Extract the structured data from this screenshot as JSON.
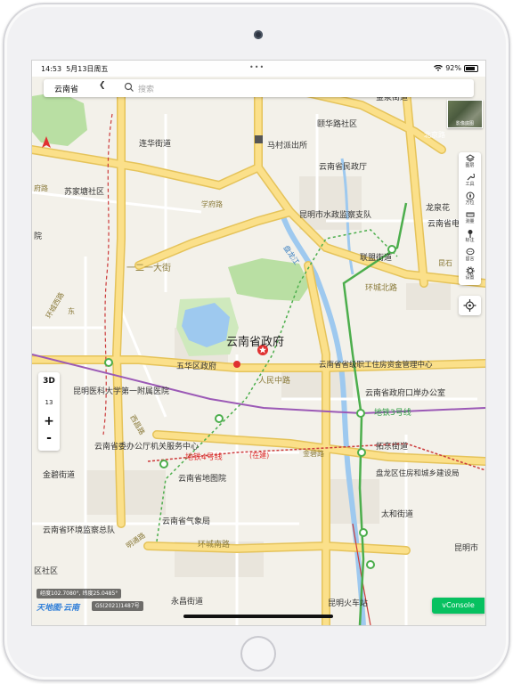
{
  "status_bar": {
    "time": "14:53",
    "date": "5月13日周五",
    "dots": "•••",
    "battery": "92%"
  },
  "search": {
    "province": "云南省",
    "placeholder": "搜索"
  },
  "imagery_thumb": {
    "label": "影像底图"
  },
  "tools": [
    {
      "icon": "layers-icon",
      "label": "图层"
    },
    {
      "icon": "wrench-icon",
      "label": "工具"
    },
    {
      "icon": "compass-needle-icon",
      "label": "方位"
    },
    {
      "icon": "ruler-icon",
      "label": "测量"
    },
    {
      "icon": "pin-icon",
      "label": "标注"
    },
    {
      "icon": "message-icon",
      "label": "留言"
    },
    {
      "icon": "gear-icon",
      "label": "设置"
    }
  ],
  "zoom": {
    "mode_3d": "3D",
    "level": "13",
    "zoom_in": "+",
    "zoom_out": "-"
  },
  "map": {
    "colors": {
      "land": "#f3f1ea",
      "block": "#e8e4da",
      "major_road": "#fbe08a",
      "major_road_edge": "#e5c35a",
      "water": "#9ec9ef",
      "park": "#b9dfa3",
      "metro": "#4cae4c",
      "rail": "#cc3b3b",
      "label": "#333333"
    },
    "labels": {
      "l01": "金泉街道",
      "l02": "颐华路社区",
      "l03": "北京路",
      "l04": "连华街道",
      "l05": "马村派出所",
      "l06": "云南省民政厅",
      "l07": "学府路",
      "l08": "苏家塘社区",
      "l09": "龙泉花",
      "l10": "昆明市水政监察支队",
      "l11": "云南省电",
      "l12": "联盟街道",
      "l13": "一二一大街",
      "l14": "昆石",
      "l15": "环城北路",
      "l16": "云南省政府",
      "l17": "五华区政府",
      "l18": "云南省省级职工住房资金管理中心",
      "l19": "人民中路",
      "l20": "昆明医科大学第一附属医院",
      "l21": "云南省政府口岸办公室",
      "l22": "地铁3号线",
      "l23": "拓东街道",
      "l24": "云南省委办公厅机关服务中心",
      "l25": "地铁4号线",
      "l26": "(在建)",
      "l27": "金碧路",
      "l28": "云南省地图院",
      "l29": "盘龙区住房和城乡建设局",
      "l30": "金碧街道",
      "l31": "云南省气象局",
      "l32": "太和街道",
      "l33": "云南省环境监察总队",
      "l34": "环城南路",
      "l35": "昆明市",
      "l36": "区社区",
      "l37": "永昌街道",
      "l38": "昆明火车站",
      "l39": "府路",
      "l40": "院",
      "l41": "西昌路",
      "l42": "东",
      "l43": "盘龙江",
      "l44": "环城西路",
      "l45": "明通路"
    }
  },
  "coord_readout": "经度102.7080°, 纬度25.0485°",
  "logo": "天地图·云南",
  "review_no": "GS(2021)1487号",
  "vconsole": "vConsole"
}
